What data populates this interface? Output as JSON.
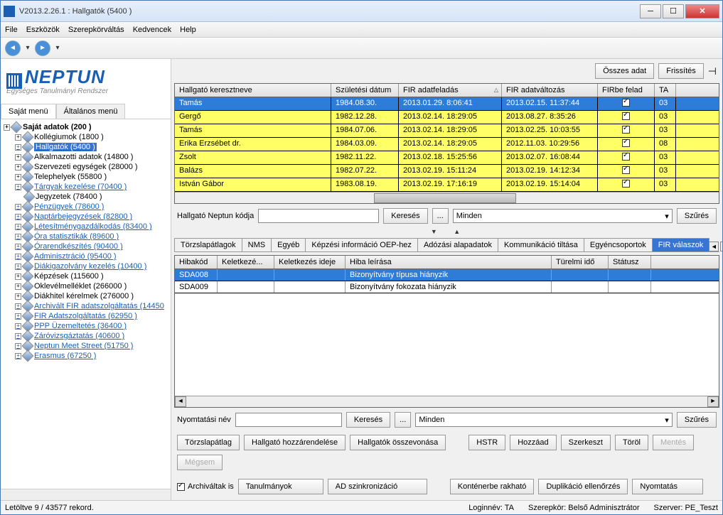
{
  "window": {
    "title": "V2013.2.26.1 : Hallgatók (5400  )"
  },
  "menu": {
    "file": "File",
    "tools": "Eszközök",
    "role": "Szerepkörváltás",
    "fav": "Kedvencek",
    "help": "Help"
  },
  "logo": {
    "text": "NEPTUN",
    "sub": "Egységes Tanulmányi Rendszer"
  },
  "side_tabs": {
    "own": "Saját menü",
    "general": "Általános menü"
  },
  "tree": [
    {
      "label": "Saját adatok (200  )",
      "bold": true,
      "blue": false
    },
    {
      "label": "Kollégiumok (1800  )",
      "child": true
    },
    {
      "label": "Hallgatók (5400  )",
      "child": true,
      "sel": true,
      "blue": true
    },
    {
      "label": "Alkalmazotti adatok (14800  )",
      "child": true
    },
    {
      "label": "Szervezeti egységek (28000  )",
      "child": true
    },
    {
      "label": "Telephelyek (55800  )",
      "child": true
    },
    {
      "label": "Tárgyak kezelése (70400  )",
      "child": true,
      "blue": true
    },
    {
      "label": "Jegyzetek (78400  )",
      "child": true,
      "noexp": true
    },
    {
      "label": "Pénzügyek (78600  )",
      "child": true,
      "blue": true
    },
    {
      "label": "Naptárbejegyzések (82800  )",
      "child": true,
      "blue": true
    },
    {
      "label": "Létesítménygazdálkodás (83400  )",
      "child": true,
      "blue": true
    },
    {
      "label": "Óra statisztikák (89600  )",
      "child": true,
      "blue": true
    },
    {
      "label": "Órarendkészítés (90400  )",
      "child": true,
      "blue": true
    },
    {
      "label": "Adminisztráció (95400  )",
      "child": true,
      "blue": true
    },
    {
      "label": "Diákigazolvány kezelés (10400  )",
      "child": true,
      "blue": true
    },
    {
      "label": "Képzések (115600  )",
      "child": true
    },
    {
      "label": "Oklevélmelléklet (266000  )",
      "child": true
    },
    {
      "label": "Diákhitel kérelmek (276000  )",
      "child": true
    },
    {
      "label": "Archivált FIR adatszolgáltatás (14450",
      "child": true,
      "blue": true
    },
    {
      "label": "FIR Adatszolgáltatás (62950  )",
      "child": true,
      "blue": true
    },
    {
      "label": "PPP Üzemeltetés (36400  )",
      "child": true,
      "blue": true
    },
    {
      "label": "Záróvizsgáztatás (40600  )",
      "child": true,
      "blue": true
    },
    {
      "label": "Neptun Meet Street (51750  )",
      "child": true,
      "blue": true
    },
    {
      "label": "Erasmus (67250  )",
      "child": true,
      "blue": true
    }
  ],
  "topbar": {
    "all": "Összes adat",
    "refresh": "Frissítés"
  },
  "grid1": {
    "cols": [
      "Hallgató keresztneve",
      "Születési dátum",
      "FIR adatfeladás",
      "FIR adatváltozás",
      "FIRbe felad",
      "TA"
    ],
    "widths": [
      220,
      95,
      145,
      135,
      80,
      30
    ],
    "rows": [
      {
        "c": [
          "Tamás",
          "1984.08.30.",
          "2013.01.29. 8:06:41",
          "2013.02.15. 11:37:44",
          "1",
          "03"
        ],
        "sel": true
      },
      {
        "c": [
          "Gergő",
          "1982.12.28.",
          "2013.02.14. 18:29:05",
          "2013.08.27. 8:35:26",
          "1",
          "03"
        ]
      },
      {
        "c": [
          "Tamás",
          "1984.07.06.",
          "2013.02.14. 18:29:05",
          "2013.02.25. 10:03:55",
          "1",
          "03"
        ]
      },
      {
        "c": [
          "Erika Erzsébet dr.",
          "1984.03.09.",
          "2013.02.14. 18:29:05",
          "2012.11.03. 10:29:56",
          "1",
          "08"
        ]
      },
      {
        "c": [
          "Zsolt",
          "1982.11.22.",
          "2013.02.18. 15:25:56",
          "2013.02.07. 16:08:44",
          "1",
          "03"
        ]
      },
      {
        "c": [
          "Balázs",
          "1982.07.22.",
          "2013.02.19. 15:11:24",
          "2013.02.19. 14:12:34",
          "1",
          "03"
        ]
      },
      {
        "c": [
          "István Gábor",
          "1983.08.19.",
          "2013.02.19. 17:16:19",
          "2013.02.19. 15:14:04",
          "1",
          "03"
        ]
      }
    ]
  },
  "search1": {
    "label": "Hallgató Neptun kódja",
    "search": "Keresés",
    "dots": "...",
    "all": "Minden",
    "filter": "Szűrés"
  },
  "subtabs": [
    "Törzslapátlagok",
    "NMS",
    "Egyéb",
    "Képzési információ OEP-hez",
    "Adózási alapadatok",
    "Kommunikáció tiltása",
    "Egyéncsoportok",
    "FIR válaszok"
  ],
  "grid2": {
    "cols": [
      "Hibakód",
      "Keletkezé...",
      "Keletkezés ideje",
      "Hiba leírása",
      "Türelmi idő",
      "Státusz"
    ],
    "widths": [
      60,
      80,
      100,
      290,
      80,
      60
    ],
    "rows": [
      {
        "c": [
          "SDA008",
          "",
          "",
          "Bizonyítvány típusa hiányzik",
          "",
          ""
        ],
        "sel": true
      },
      {
        "c": [
          "SDA009",
          "",
          "",
          "Bizonyítvány fokozata hiányzik",
          "",
          ""
        ]
      }
    ]
  },
  "search2": {
    "label": "Nyomtatási név",
    "search": "Keresés",
    "dots": "...",
    "all": "Minden",
    "filter": "Szűrés"
  },
  "btns1": {
    "torzs": "Törzslapátlag",
    "assign": "Hallgató hozzárendelése",
    "merge": "Hallgatók összevonása",
    "hstr": "HSTR",
    "add": "Hozzáad",
    "edit": "Szerkeszt",
    "del": "Töröl",
    "save": "Mentés",
    "cancel": "Mégsem"
  },
  "btns2": {
    "arch": "Archiváltak is",
    "studies": "Tanulmányok",
    "adsync": "AD szinkronizáció",
    "container": "Konténerbe rakható",
    "dup": "Duplikáció ellenőrzés",
    "print": "Nyomtatás"
  },
  "status": {
    "records": "Letöltve 9 / 43577 rekord.",
    "login": "Loginnév: TA",
    "role": "Szerepkör: Belső Adminisztrátor",
    "server": "Szerver: PE_Teszt"
  }
}
